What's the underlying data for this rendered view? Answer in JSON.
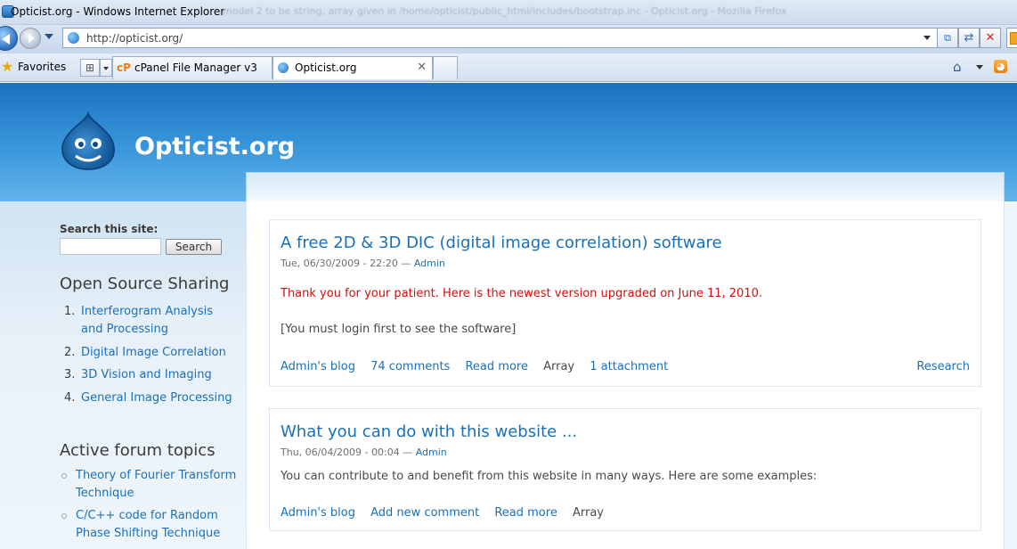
{
  "window": {
    "title": "Opticist.org - Windows Internet Explorer",
    "background_title": "model 2 to be string, array given in /home/opticist/public_html/includes/bootstrap.inc - Opticist.org - Mozilla Firefox"
  },
  "address_bar": {
    "url": "http://opticist.org/"
  },
  "favorites": {
    "label": "Favorites"
  },
  "tabs": [
    {
      "label": "cPanel File Manager v3",
      "icon": "cpanel-icon"
    },
    {
      "label": "Opticist.org",
      "icon": "globe-icon",
      "active": true
    }
  ],
  "icons": {
    "cpanel_glyph": "cP",
    "rss_glyph": "◕",
    "home_glyph": "⌂",
    "close_glyph": "✕",
    "refresh_glyph": "⇄",
    "compat_glyph": "⧉"
  },
  "site": {
    "name": "Opticist.org"
  },
  "sidebar": {
    "search_label": "Search this site:",
    "search_value": "",
    "search_button": "Search",
    "block1_title": "Open Source Sharing",
    "block1_items": [
      {
        "num": "1.",
        "label": "Interferogram Analysis and Processing"
      },
      {
        "num": "2.",
        "label": "Digital Image Correlation"
      },
      {
        "num": "3.",
        "label": "3D Vision and Imaging"
      },
      {
        "num": "4.",
        "label": "General Image Processing"
      }
    ],
    "block2_title": "Active forum topics",
    "block2_items": [
      {
        "label": "Theory of Fourier Transform Technique"
      },
      {
        "label": "C/C++ code for Random Phase Shifting Technique"
      }
    ]
  },
  "nodes": [
    {
      "title": "A free 2D & 3D DIC (digital image correlation) software",
      "date": "Tue, 06/30/2009 - 22:20 —",
      "author": "Admin",
      "body_red": "Thank you for your patient. Here is the newest version upgraded on June 11, 2010.",
      "body": "[You must login first to see the software]",
      "links": [
        "Admin's blog",
        "74 comments",
        "Read more"
      ],
      "array_text": "Array",
      "attachment": "1 attachment",
      "taxonomy": "Research"
    },
    {
      "title": "What you can do with this website ...",
      "date": "Thu, 06/04/2009 - 00:04 —",
      "author": "Admin",
      "body": "You can contribute to and benefit from this website in many ways. Here are some examples:",
      "links": [
        "Admin's blog",
        "Add new comment",
        "Read more"
      ],
      "array_text": "Array"
    }
  ]
}
